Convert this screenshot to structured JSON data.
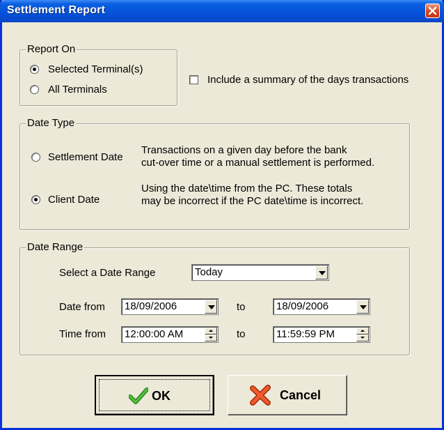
{
  "window": {
    "title": "Settlement Report"
  },
  "report_on": {
    "legend": "Report On",
    "options": [
      {
        "label": "Selected Terminal(s)",
        "selected": true
      },
      {
        "label": "All Terminals",
        "selected": false
      }
    ]
  },
  "summary_checkbox": {
    "label": "Include a summary of the days transactions",
    "checked": false
  },
  "date_type": {
    "legend": "Date Type",
    "settlement": {
      "label": "Settlement Date",
      "selected": false,
      "desc1": "Transactions on a given day before the bank",
      "desc2": "cut-over time or a manual settlement is performed."
    },
    "client": {
      "label": "Client Date",
      "selected": true,
      "desc1": "Using the date\\time from the PC. These totals",
      "desc2": "may be incorrect if the PC date\\time is incorrect."
    }
  },
  "date_range": {
    "legend": "Date Range",
    "select_label": "Select a Date Range",
    "select_value": "Today",
    "date_from_label": "Date from",
    "date_from": "18/09/2006",
    "date_to_label": "to",
    "date_to": "18/09/2006",
    "time_from_label": "Time from",
    "time_from": "12:00:00 AM",
    "time_to_label": "to",
    "time_to": "11:59:59 PM"
  },
  "buttons": {
    "ok": "OK",
    "cancel": "Cancel"
  },
  "icons": {
    "close": "close-icon",
    "ok": "checkmark-icon",
    "cancel": "x-cross-icon"
  },
  "colors": {
    "titlebar": "#0451d9",
    "dialog_bg": "#ece9d8",
    "close_button": "#d2451e",
    "ok_check": "#3aa52b",
    "cancel_x": "#e2481c"
  }
}
